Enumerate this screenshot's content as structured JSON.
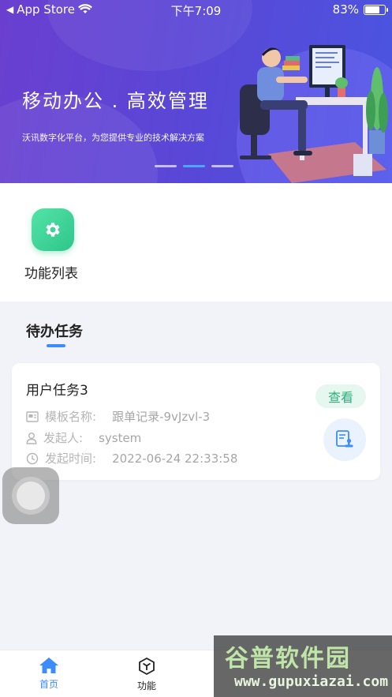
{
  "status_bar": {
    "carrier": "App Store",
    "time": "下午7:09",
    "battery": "83%",
    "battery_level": 0.83
  },
  "banner": {
    "title": "移动办公 . 高效管理",
    "subtitle": "沃讯数字化平台，为您提供专业的技术解决方案",
    "page_count": 3,
    "active_page": 1
  },
  "features": {
    "items": [
      {
        "label": "功能列表",
        "icon": "gear-icon"
      }
    ]
  },
  "pending": {
    "title": "待办任务",
    "tasks": [
      {
        "name": "用户任务3",
        "template_label": "模板名称:",
        "template_value": "跟单记录-9vJzvl-3",
        "initiator_label": "发起人:",
        "initiator_value": "system",
        "time_label": "发起时间:",
        "time_value": "2022-06-24 22:33:58",
        "action_label": "查看"
      }
    ]
  },
  "tabbar": {
    "home_label": "首页",
    "func_label": "功能"
  },
  "watermark": {
    "logo": "谷普软件园",
    "url": "www.gupuxiazai.com"
  },
  "colors": {
    "accent": "#3d8bfd",
    "green": "#2fb07d",
    "banner_start": "#6a3fd0",
    "banner_end": "#4a55e0"
  }
}
